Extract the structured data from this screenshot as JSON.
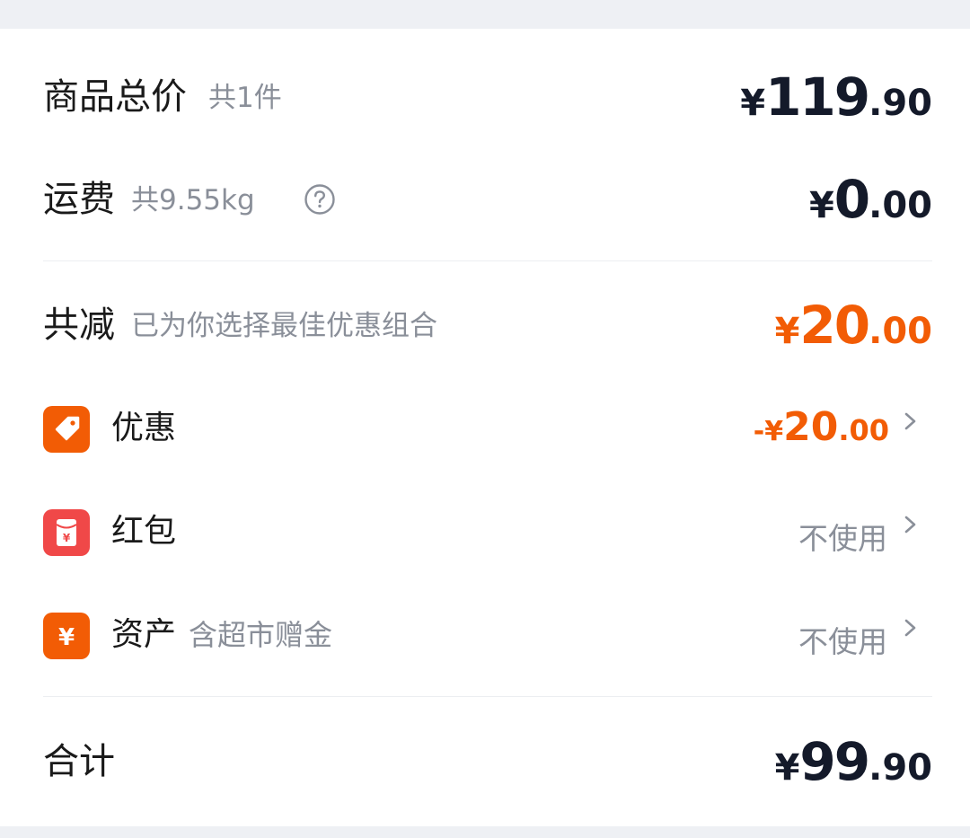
{
  "colors": {
    "accent_orange": "#f25c05",
    "price_dark": "#141a2a",
    "muted_gray": "#8a8f99",
    "red": "#f04848"
  },
  "goods_total": {
    "label": "商品总价",
    "note": "共1件",
    "currency": "¥",
    "int": "119",
    "dec": ".90"
  },
  "shipping": {
    "label": "运费",
    "note": "共9.55kg",
    "currency": "¥",
    "int": "0",
    "dec": ".00"
  },
  "reduction": {
    "label": "共减",
    "note": "已为你选择最佳优惠组合",
    "currency": "¥",
    "int": "20",
    "dec": ".00"
  },
  "discount": {
    "label": "优惠",
    "icon": "tag-icon",
    "value_prefix": "-",
    "currency": "¥",
    "int": "20",
    "dec": ".00"
  },
  "red_packet": {
    "label": "红包",
    "icon": "red-packet-icon",
    "value": "不使用"
  },
  "assets": {
    "label": "资产",
    "note": "含超市赠金",
    "icon": "yuan-icon",
    "value": "不使用"
  },
  "total": {
    "label": "合计",
    "currency": "¥",
    "int": "99",
    "dec": ".90"
  }
}
